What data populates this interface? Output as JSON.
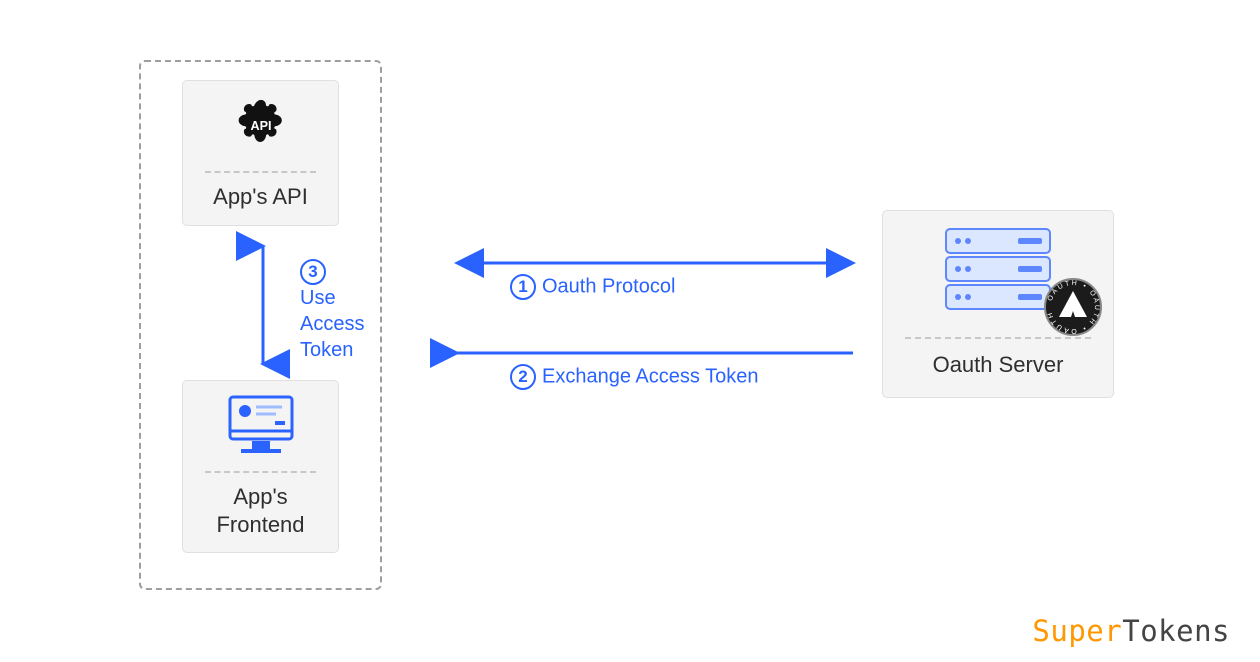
{
  "nodes": {
    "api": {
      "label": "App's API"
    },
    "frontend_line1": "App's",
    "frontend_line2": "Frontend",
    "server": {
      "label": "Oauth Server"
    }
  },
  "steps": {
    "s1": {
      "num": "1",
      "label": "Oauth Protocol"
    },
    "s2": {
      "num": "2",
      "label": "Exchange Access Token"
    },
    "s3": {
      "num": "3",
      "line1": "Use",
      "line2": "Access",
      "line3": "Token"
    }
  },
  "logo": {
    "part1": "Super",
    "part2": "Tokens"
  },
  "colors": {
    "arrow": "#2962ff",
    "card_bg": "#f4f4f4"
  }
}
